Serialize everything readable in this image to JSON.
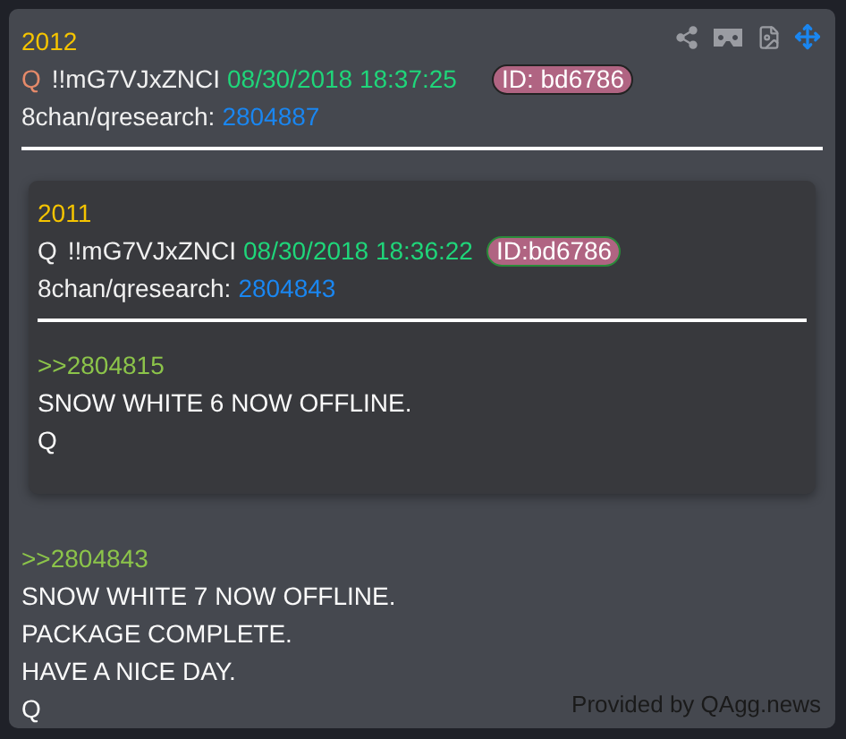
{
  "post": {
    "number": "2012",
    "author": "Q",
    "author_highlighted": true,
    "tripcode": "!!mG7VJxZNCI",
    "timestamp": "08/30/2018 18:37:25",
    "id_badge": "ID: bd6786",
    "board": "8chan/qresearch:",
    "post_link": "2804887",
    "quoted": {
      "number": "2011",
      "author": "Q",
      "author_highlighted": false,
      "tripcode": "!!mG7VJxZNCI",
      "timestamp": "08/30/2018 18:36:22",
      "id_badge": "ID:bd6786",
      "board": "8chan/qresearch:",
      "post_link": "2804843",
      "body": [
        {
          "kind": "reply_link",
          "text": ">>2804815"
        },
        {
          "kind": "line",
          "text": "SNOW WHITE 6 NOW OFFLINE."
        },
        {
          "kind": "line",
          "text": "Q"
        }
      ]
    },
    "body": [
      {
        "kind": "reply_link",
        "text": ">>2804843"
      },
      {
        "kind": "line",
        "text": "SNOW WHITE 7 NOW OFFLINE."
      },
      {
        "kind": "line",
        "text": "PACKAGE COMPLETE."
      },
      {
        "kind": "line",
        "text": "HAVE A NICE DAY."
      },
      {
        "kind": "line",
        "text": "Q"
      }
    ]
  },
  "footer": "Provided by QAgg.news"
}
